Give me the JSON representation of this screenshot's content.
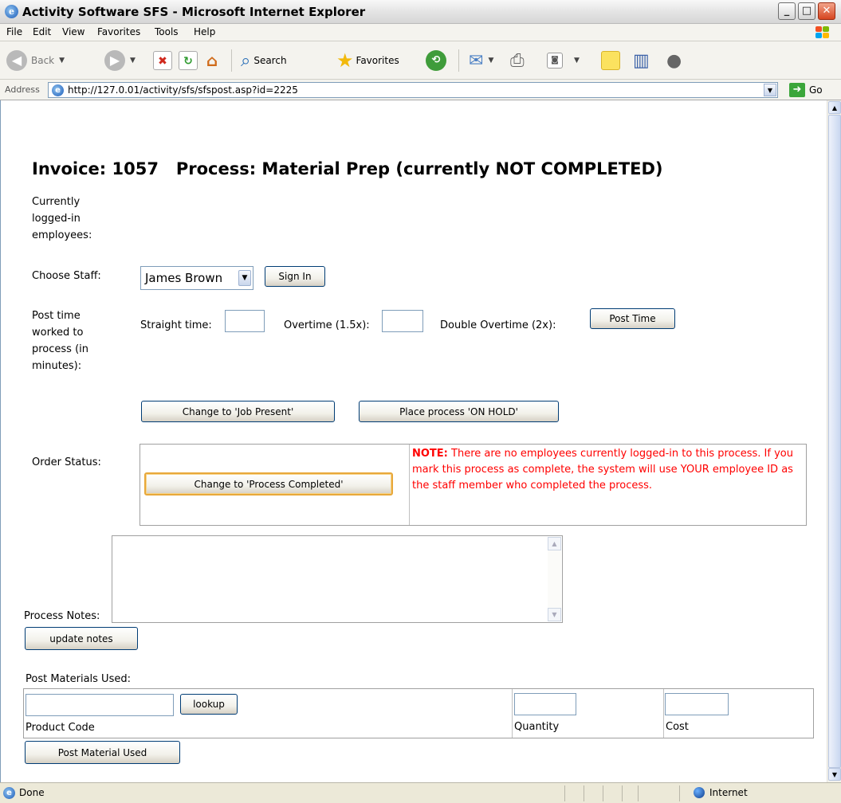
{
  "window": {
    "title": "Activity Software SFS - Microsoft Internet Explorer",
    "ie_icon": "ie-logo-icon",
    "minimize": "_",
    "maximize": "□",
    "close": "X"
  },
  "menu": {
    "items": [
      {
        "label": "File"
      },
      {
        "label": "Edit"
      },
      {
        "label": "View"
      },
      {
        "label": "Favorites"
      },
      {
        "label": "Tools"
      },
      {
        "label": "Help"
      }
    ]
  },
  "toolbar": {
    "back_label": "Back",
    "search_label": "Search",
    "favorites_label": "Favorites"
  },
  "address": {
    "label": "Address",
    "url": "http://127.0.01/activity/sfs/sfspost.asp?id=2225",
    "go_label": "Go"
  },
  "page": {
    "title": "Invoice: 1057   Process: Material Prep (currently NOT COMPLETED)",
    "logged_in_label": "Currently logged-in employees:",
    "choose_staff_label": "Choose Staff:",
    "staff_selected": "James Brown",
    "sign_in_button": "Sign In",
    "post_time_label": "Post time worked to process (in minutes):",
    "straight_time_label": "Straight time:",
    "straight_time_value": "",
    "overtime_label": "Overtime (1.5x):",
    "overtime_value": "",
    "double_overtime_label": "Double Overtime (2x):",
    "post_time_button": "Post Time",
    "job_present_button": "Change to 'Job Present'",
    "on_hold_button": "Place process 'ON HOLD'",
    "order_status_label": "Order Status:",
    "process_completed_button": "Change to 'Process Completed'",
    "note_prefix": "NOTE:",
    "note_text": " There are no employees currently logged-in to this process. If you mark this process as complete, the system will use YOUR employee ID as the staff member who completed the process.",
    "process_notes_label": "Process Notes:",
    "process_notes_value": "",
    "update_notes_button": "update notes",
    "post_materials_label": "Post Materials Used:",
    "product_code_value": "",
    "lookup_button": "lookup",
    "product_code_label": "Product Code",
    "quantity_value": "",
    "quantity_label": "Quantity",
    "cost_value": "",
    "cost_label": "Cost",
    "post_material_button": "Post Material Used"
  },
  "statusbar": {
    "status_text": "Done",
    "zone_text": "Internet"
  }
}
